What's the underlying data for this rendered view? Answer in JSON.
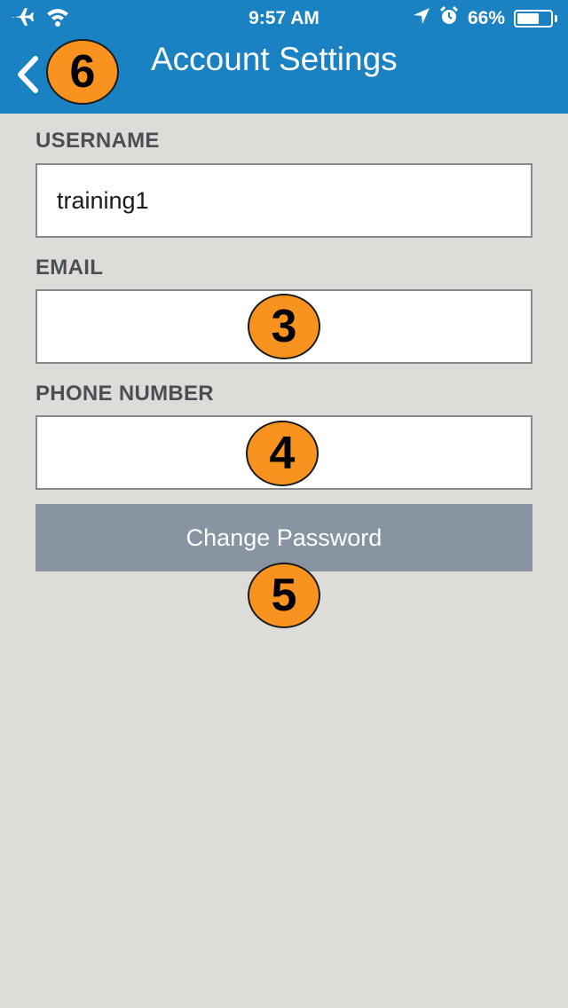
{
  "status_bar": {
    "time": "9:57 AM",
    "battery_percent": "66%",
    "battery_level": 0.66,
    "icons": [
      "airplane-mode-icon",
      "wifi-icon",
      "location-arrow-icon",
      "alarm-icon",
      "battery-icon"
    ]
  },
  "nav": {
    "title": "Account Settings",
    "back_icon": "chevron-left-icon"
  },
  "form": {
    "username_label": "USERNAME",
    "username_value": "training1",
    "email_label": "EMAIL",
    "email_value": "",
    "phone_label": "PHONE NUMBER",
    "phone_value": "",
    "change_password_label": "Change Password"
  },
  "callouts": {
    "back": "6",
    "email": "3",
    "phone": "4",
    "change_password": "5"
  },
  "colors": {
    "header": "#1a82c3",
    "background": "#dddcd8",
    "button": "#8894a1",
    "callout": "#f7931e"
  }
}
